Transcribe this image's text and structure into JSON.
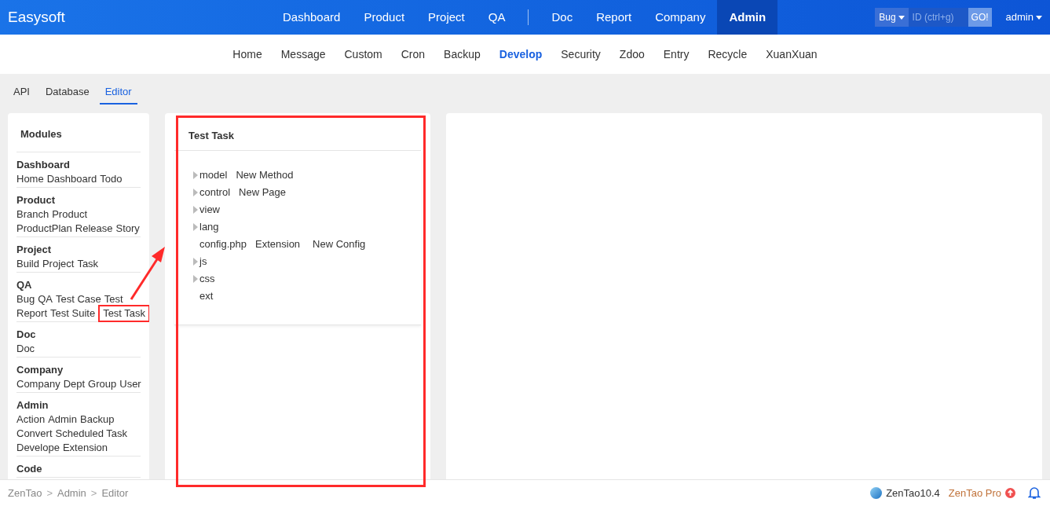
{
  "header": {
    "brand": "Easysoft",
    "nav_groups": [
      {
        "items": [
          {
            "label": "Dashboard",
            "selected": false
          },
          {
            "label": "Product",
            "selected": false
          },
          {
            "label": "Project",
            "selected": false
          },
          {
            "label": "QA",
            "selected": false
          }
        ]
      },
      {
        "items": [
          {
            "label": "Doc",
            "selected": false
          },
          {
            "label": "Report",
            "selected": false
          },
          {
            "label": "Company",
            "selected": false
          },
          {
            "label": "Admin",
            "selected": true
          }
        ]
      }
    ],
    "search": {
      "type": "Bug",
      "placeholder": "ID (ctrl+g)",
      "button": "GO!"
    },
    "user": "admin"
  },
  "subnav": [
    {
      "label": "Home",
      "selected": false
    },
    {
      "label": "Message",
      "selected": false
    },
    {
      "label": "Custom",
      "selected": false
    },
    {
      "label": "Cron",
      "selected": false
    },
    {
      "label": "Backup",
      "selected": false
    },
    {
      "label": "Develop",
      "selected": true
    },
    {
      "label": "Security",
      "selected": false
    },
    {
      "label": "Zdoo",
      "selected": false
    },
    {
      "label": "Entry",
      "selected": false
    },
    {
      "label": "Recycle",
      "selected": false
    },
    {
      "label": "XuanXuan",
      "selected": false
    }
  ],
  "tabs": [
    {
      "label": "API",
      "selected": false
    },
    {
      "label": "Database",
      "selected": false
    },
    {
      "label": "Editor",
      "selected": true
    }
  ],
  "sidebar": {
    "title": "Modules",
    "groups": [
      {
        "title": "Dashboard",
        "lines": [
          [
            {
              "label": "Home",
              "annotated": false
            },
            {
              "label": "Dashboard",
              "annotated": false
            },
            {
              "label": "Todo",
              "annotated": false
            }
          ]
        ]
      },
      {
        "title": "Product",
        "lines": [
          [
            {
              "label": "Branch",
              "annotated": false
            },
            {
              "label": "Product",
              "annotated": false
            }
          ],
          [
            {
              "label": "ProductPlan",
              "annotated": false
            },
            {
              "label": "Release",
              "annotated": false
            },
            {
              "label": "Story",
              "annotated": false
            }
          ]
        ]
      },
      {
        "title": "Project",
        "lines": [
          [
            {
              "label": "Build",
              "annotated": false
            },
            {
              "label": "Project",
              "annotated": false
            },
            {
              "label": "Task",
              "annotated": false
            }
          ]
        ]
      },
      {
        "title": "QA",
        "lines": [
          [
            {
              "label": "Bug",
              "annotated": false
            },
            {
              "label": "QA",
              "annotated": false
            },
            {
              "label": "Test Case",
              "annotated": false
            },
            {
              "label": "Test",
              "annotated": false
            }
          ],
          [
            {
              "label": "Report",
              "annotated": false
            },
            {
              "label": "Test Suite",
              "annotated": false
            },
            {
              "label": "Test Task",
              "annotated": true
            }
          ]
        ]
      },
      {
        "title": "Doc",
        "lines": [
          [
            {
              "label": "Doc",
              "annotated": false
            }
          ]
        ]
      },
      {
        "title": "Company",
        "lines": [
          [
            {
              "label": "Company",
              "annotated": false
            },
            {
              "label": "Dept",
              "annotated": false
            },
            {
              "label": "Group",
              "annotated": false
            },
            {
              "label": "User",
              "annotated": false
            }
          ]
        ]
      },
      {
        "title": "Admin",
        "lines": [
          [
            {
              "label": "Action",
              "annotated": false
            },
            {
              "label": "Admin",
              "annotated": false
            },
            {
              "label": "Backup",
              "annotated": false
            }
          ],
          [
            {
              "label": "Convert",
              "annotated": false
            },
            {
              "label": "Scheduled Task",
              "annotated": false
            }
          ],
          [
            {
              "label": "Develope",
              "annotated": false
            },
            {
              "label": "Extension",
              "annotated": false
            }
          ]
        ]
      },
      {
        "title": "Code"
      }
    ]
  },
  "editor": {
    "title": "Test Task",
    "annotated": true,
    "tree": [
      {
        "kind": "folder",
        "name": "model",
        "expanded": false,
        "actions": [
          "New Method"
        ]
      },
      {
        "kind": "folder",
        "name": "control",
        "expanded": false,
        "actions": [
          "New Page"
        ]
      },
      {
        "kind": "folder",
        "name": "view",
        "expanded": false
      },
      {
        "kind": "folder",
        "name": "lang",
        "expanded": false
      },
      {
        "kind": "file",
        "name": "config.php",
        "actions": [
          "Extension",
          "New Config"
        ]
      },
      {
        "kind": "folder",
        "name": "js",
        "expanded": false
      },
      {
        "kind": "folder",
        "name": "css",
        "expanded": false
      },
      {
        "kind": "file",
        "name": "ext"
      }
    ]
  },
  "footer": {
    "breadcrumb": [
      "ZenTao",
      "Admin",
      "Editor"
    ],
    "separator": ">",
    "version": "ZenTao10.4",
    "pro": "ZenTao Pro"
  }
}
